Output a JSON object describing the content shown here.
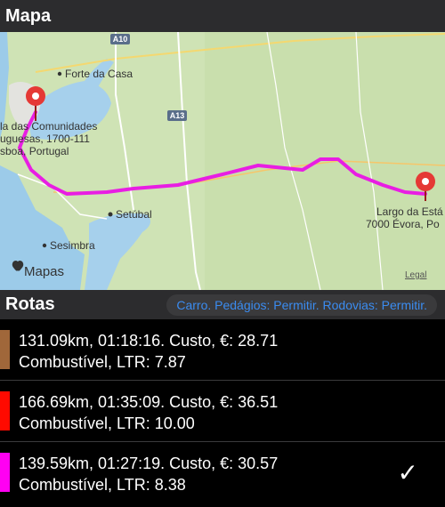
{
  "map_section": {
    "title": "Mapa",
    "attribution": "Mapas",
    "legal": "Legal",
    "place_labels": {
      "forte": "Forte da Casa",
      "setubal": "Setúbal",
      "sesimbra": "Sesimbra"
    },
    "road_badges": {
      "a10": "A10",
      "a13": "A13"
    },
    "start_pin": {
      "lines": [
        "la das Comunidades",
        "uguesas, 1700-111",
        "sboa, Portugal"
      ]
    },
    "end_pin": {
      "lines": [
        "Largo da Está",
        "7000 Évora, Po"
      ]
    },
    "route_color": "#e81ee3"
  },
  "routes_section": {
    "title": "Rotas",
    "filter": "Carro. Pedágios: Permitir. Rodovias: Permitir."
  },
  "routes": [
    {
      "line1": "131.09km, 01:18:16. Custo, €: 28.71",
      "line2": "Combustível, LTR: 7.87",
      "color": "#a0673a",
      "selected": false
    },
    {
      "line1": "166.69km, 01:35:09. Custo, €: 36.51",
      "line2": "Combustível, LTR: 10.00",
      "color": "#ff0a00",
      "selected": false
    },
    {
      "line1": "139.59km, 01:27:19. Custo, €: 30.57",
      "line2": "Combustível, LTR: 8.38",
      "color": "#ff00f2",
      "selected": true,
      "check": "✓"
    }
  ]
}
